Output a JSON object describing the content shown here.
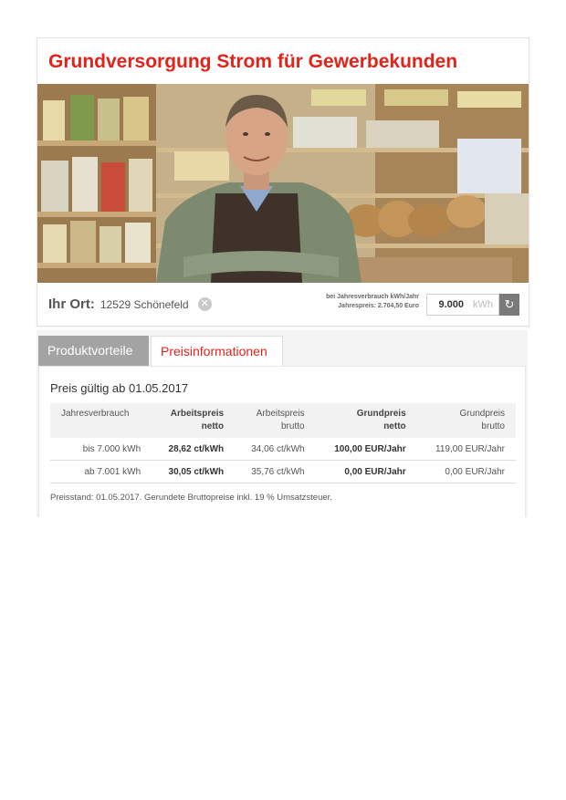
{
  "header": {
    "title": "Grundversorgung Strom für Gewerbekunden"
  },
  "location": {
    "label": "Ihr Ort:",
    "value": "12529 Schönefeld",
    "clear_icon": "close-icon"
  },
  "consumption": {
    "hint_line1": "bei Jahresverbrauch kWh/Jahr",
    "hint_line2": "Jahrespreis: 2.704,50 Euro",
    "value": "9.000",
    "unit": "kWh",
    "refresh_icon": "refresh-icon"
  },
  "tabs": [
    {
      "label": "Produktvorteile",
      "active": false
    },
    {
      "label": "Preisinformationen",
      "active": true
    }
  ],
  "prices": {
    "valid_from": "Preis gültig ab 01.05.2017",
    "headers": [
      {
        "line1": "Jahresverbrauch",
        "line2": ""
      },
      {
        "line1": "Arbeitspreis",
        "line2": "netto"
      },
      {
        "line1": "Arbeitspreis",
        "line2": "brutto"
      },
      {
        "line1": "Grundpreis",
        "line2": "netto"
      },
      {
        "line1": "Grundpreis",
        "line2": "brutto"
      }
    ],
    "rows": [
      [
        "bis 7.000 kWh",
        "28,62 ct/kWh",
        "34,06 ct/kWh",
        "100,00 EUR/Jahr",
        "119,00 EUR/Jahr"
      ],
      [
        "ab 7.001 kWh",
        "30,05 ct/kWh",
        "35,76 ct/kWh",
        "0,00 EUR/Jahr",
        "0,00 EUR/Jahr"
      ]
    ],
    "footnote": "Preisstand: 01.05.2017. Gerundete Bruttopreise inkl. 19 % Umsatzsteuer."
  },
  "colors": {
    "accent": "#e2231a",
    "tab_inactive": "#a3a3a3",
    "button_gray": "#7a7a7a"
  }
}
